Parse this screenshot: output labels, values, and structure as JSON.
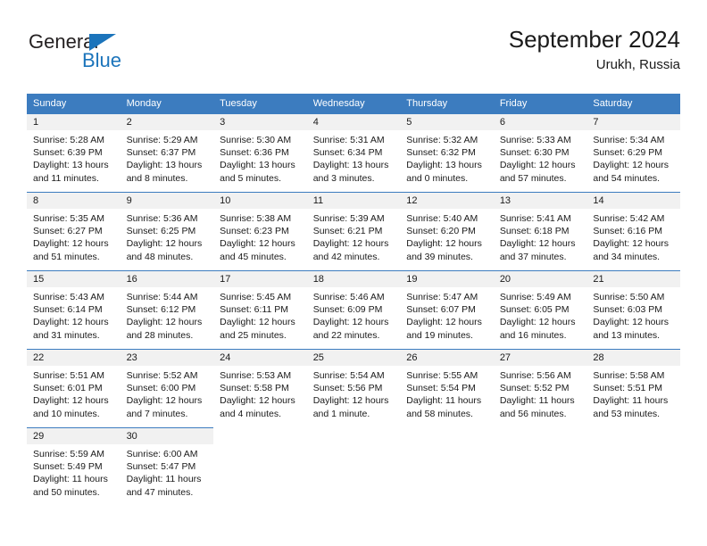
{
  "logo": {
    "word_one": "General",
    "word_two": "Blue",
    "triangle_color": "#1b74bb",
    "text_color": "#231f20"
  },
  "header": {
    "title": "September 2024",
    "subtitle": "Urukh, Russia"
  },
  "colors": {
    "header_blue": "#3c7cbf",
    "daynum_gray": "#f1f1f1",
    "text": "#1a1a1a"
  },
  "weekday_headers": [
    "Sunday",
    "Monday",
    "Tuesday",
    "Wednesday",
    "Thursday",
    "Friday",
    "Saturday"
  ],
  "weeks": [
    [
      {
        "day": "1",
        "sunrise": "Sunrise: 5:28 AM",
        "sunset": "Sunset: 6:39 PM",
        "daylight_line1": "Daylight: 13 hours",
        "daylight_line2": "and 11 minutes."
      },
      {
        "day": "2",
        "sunrise": "Sunrise: 5:29 AM",
        "sunset": "Sunset: 6:37 PM",
        "daylight_line1": "Daylight: 13 hours",
        "daylight_line2": "and 8 minutes."
      },
      {
        "day": "3",
        "sunrise": "Sunrise: 5:30 AM",
        "sunset": "Sunset: 6:36 PM",
        "daylight_line1": "Daylight: 13 hours",
        "daylight_line2": "and 5 minutes."
      },
      {
        "day": "4",
        "sunrise": "Sunrise: 5:31 AM",
        "sunset": "Sunset: 6:34 PM",
        "daylight_line1": "Daylight: 13 hours",
        "daylight_line2": "and 3 minutes."
      },
      {
        "day": "5",
        "sunrise": "Sunrise: 5:32 AM",
        "sunset": "Sunset: 6:32 PM",
        "daylight_line1": "Daylight: 13 hours",
        "daylight_line2": "and 0 minutes."
      },
      {
        "day": "6",
        "sunrise": "Sunrise: 5:33 AM",
        "sunset": "Sunset: 6:30 PM",
        "daylight_line1": "Daylight: 12 hours",
        "daylight_line2": "and 57 minutes."
      },
      {
        "day": "7",
        "sunrise": "Sunrise: 5:34 AM",
        "sunset": "Sunset: 6:29 PM",
        "daylight_line1": "Daylight: 12 hours",
        "daylight_line2": "and 54 minutes."
      }
    ],
    [
      {
        "day": "8",
        "sunrise": "Sunrise: 5:35 AM",
        "sunset": "Sunset: 6:27 PM",
        "daylight_line1": "Daylight: 12 hours",
        "daylight_line2": "and 51 minutes."
      },
      {
        "day": "9",
        "sunrise": "Sunrise: 5:36 AM",
        "sunset": "Sunset: 6:25 PM",
        "daylight_line1": "Daylight: 12 hours",
        "daylight_line2": "and 48 minutes."
      },
      {
        "day": "10",
        "sunrise": "Sunrise: 5:38 AM",
        "sunset": "Sunset: 6:23 PM",
        "daylight_line1": "Daylight: 12 hours",
        "daylight_line2": "and 45 minutes."
      },
      {
        "day": "11",
        "sunrise": "Sunrise: 5:39 AM",
        "sunset": "Sunset: 6:21 PM",
        "daylight_line1": "Daylight: 12 hours",
        "daylight_line2": "and 42 minutes."
      },
      {
        "day": "12",
        "sunrise": "Sunrise: 5:40 AM",
        "sunset": "Sunset: 6:20 PM",
        "daylight_line1": "Daylight: 12 hours",
        "daylight_line2": "and 39 minutes."
      },
      {
        "day": "13",
        "sunrise": "Sunrise: 5:41 AM",
        "sunset": "Sunset: 6:18 PM",
        "daylight_line1": "Daylight: 12 hours",
        "daylight_line2": "and 37 minutes."
      },
      {
        "day": "14",
        "sunrise": "Sunrise: 5:42 AM",
        "sunset": "Sunset: 6:16 PM",
        "daylight_line1": "Daylight: 12 hours",
        "daylight_line2": "and 34 minutes."
      }
    ],
    [
      {
        "day": "15",
        "sunrise": "Sunrise: 5:43 AM",
        "sunset": "Sunset: 6:14 PM",
        "daylight_line1": "Daylight: 12 hours",
        "daylight_line2": "and 31 minutes."
      },
      {
        "day": "16",
        "sunrise": "Sunrise: 5:44 AM",
        "sunset": "Sunset: 6:12 PM",
        "daylight_line1": "Daylight: 12 hours",
        "daylight_line2": "and 28 minutes."
      },
      {
        "day": "17",
        "sunrise": "Sunrise: 5:45 AM",
        "sunset": "Sunset: 6:11 PM",
        "daylight_line1": "Daylight: 12 hours",
        "daylight_line2": "and 25 minutes."
      },
      {
        "day": "18",
        "sunrise": "Sunrise: 5:46 AM",
        "sunset": "Sunset: 6:09 PM",
        "daylight_line1": "Daylight: 12 hours",
        "daylight_line2": "and 22 minutes."
      },
      {
        "day": "19",
        "sunrise": "Sunrise: 5:47 AM",
        "sunset": "Sunset: 6:07 PM",
        "daylight_line1": "Daylight: 12 hours",
        "daylight_line2": "and 19 minutes."
      },
      {
        "day": "20",
        "sunrise": "Sunrise: 5:49 AM",
        "sunset": "Sunset: 6:05 PM",
        "daylight_line1": "Daylight: 12 hours",
        "daylight_line2": "and 16 minutes."
      },
      {
        "day": "21",
        "sunrise": "Sunrise: 5:50 AM",
        "sunset": "Sunset: 6:03 PM",
        "daylight_line1": "Daylight: 12 hours",
        "daylight_line2": "and 13 minutes."
      }
    ],
    [
      {
        "day": "22",
        "sunrise": "Sunrise: 5:51 AM",
        "sunset": "Sunset: 6:01 PM",
        "daylight_line1": "Daylight: 12 hours",
        "daylight_line2": "and 10 minutes."
      },
      {
        "day": "23",
        "sunrise": "Sunrise: 5:52 AM",
        "sunset": "Sunset: 6:00 PM",
        "daylight_line1": "Daylight: 12 hours",
        "daylight_line2": "and 7 minutes."
      },
      {
        "day": "24",
        "sunrise": "Sunrise: 5:53 AM",
        "sunset": "Sunset: 5:58 PM",
        "daylight_line1": "Daylight: 12 hours",
        "daylight_line2": "and 4 minutes."
      },
      {
        "day": "25",
        "sunrise": "Sunrise: 5:54 AM",
        "sunset": "Sunset: 5:56 PM",
        "daylight_line1": "Daylight: 12 hours",
        "daylight_line2": "and 1 minute."
      },
      {
        "day": "26",
        "sunrise": "Sunrise: 5:55 AM",
        "sunset": "Sunset: 5:54 PM",
        "daylight_line1": "Daylight: 11 hours",
        "daylight_line2": "and 58 minutes."
      },
      {
        "day": "27",
        "sunrise": "Sunrise: 5:56 AM",
        "sunset": "Sunset: 5:52 PM",
        "daylight_line1": "Daylight: 11 hours",
        "daylight_line2": "and 56 minutes."
      },
      {
        "day": "28",
        "sunrise": "Sunrise: 5:58 AM",
        "sunset": "Sunset: 5:51 PM",
        "daylight_line1": "Daylight: 11 hours",
        "daylight_line2": "and 53 minutes."
      }
    ],
    [
      {
        "day": "29",
        "sunrise": "Sunrise: 5:59 AM",
        "sunset": "Sunset: 5:49 PM",
        "daylight_line1": "Daylight: 11 hours",
        "daylight_line2": "and 50 minutes."
      },
      {
        "day": "30",
        "sunrise": "Sunrise: 6:00 AM",
        "sunset": "Sunset: 5:47 PM",
        "daylight_line1": "Daylight: 11 hours",
        "daylight_line2": "and 47 minutes."
      },
      {
        "day": "",
        "sunrise": "",
        "sunset": "",
        "daylight_line1": "",
        "daylight_line2": ""
      },
      {
        "day": "",
        "sunrise": "",
        "sunset": "",
        "daylight_line1": "",
        "daylight_line2": ""
      },
      {
        "day": "",
        "sunrise": "",
        "sunset": "",
        "daylight_line1": "",
        "daylight_line2": ""
      },
      {
        "day": "",
        "sunrise": "",
        "sunset": "",
        "daylight_line1": "",
        "daylight_line2": ""
      },
      {
        "day": "",
        "sunrise": "",
        "sunset": "",
        "daylight_line1": "",
        "daylight_line2": ""
      }
    ]
  ]
}
